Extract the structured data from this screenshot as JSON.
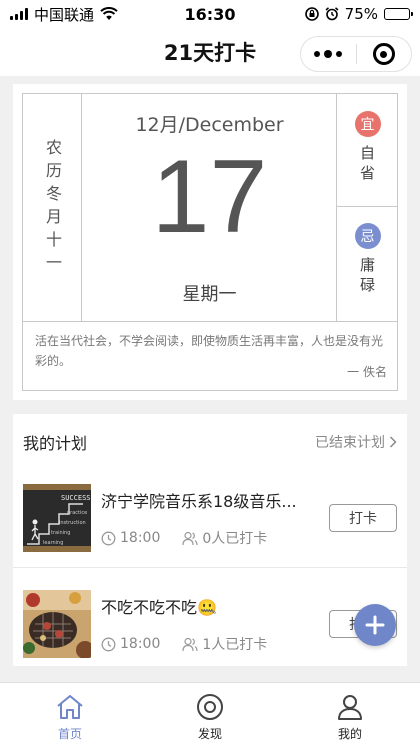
{
  "status_bar": {
    "carrier": "中国联通",
    "time": "16:30",
    "battery_text": "75%",
    "battery_level": 0.75,
    "icons": [
      "signal-icon",
      "wifi-icon",
      "rotation-lock-icon",
      "alarm-icon",
      "battery-icon"
    ]
  },
  "nav": {
    "title": "21天打卡",
    "more_icon": "more-dots-icon",
    "close_icon": "target-close-icon"
  },
  "calendar": {
    "lunar": "农历冬月十一",
    "month": "12月/December",
    "day": "17",
    "weekday": "星期一",
    "yi": {
      "badge": "宜",
      "text": "自省",
      "color": "#e8736c"
    },
    "ji": {
      "badge": "忌",
      "text": "庸碌",
      "color": "#7b8fd0"
    },
    "quote": "活在当代社会，不学会阅读，即使物质生活再丰富，人也是没有光彩的。",
    "author": "一 佚名"
  },
  "plans": {
    "title": "我的计划",
    "ended_label": "已结束计划",
    "items": [
      {
        "name": "济宁学院音乐系18级音乐...",
        "time": "18:00",
        "checkins": "0人已打卡",
        "button": "打卡",
        "thumb": "success-stairs-chalkboard"
      },
      {
        "name": "不吃不吃不吃🤐",
        "time": "18:00",
        "checkins": "1人已打卡",
        "button": "打卡",
        "thumb": "grill-food"
      }
    ]
  },
  "fab": {
    "icon": "plus-icon"
  },
  "tabs": [
    {
      "label": "首页",
      "icon": "home-icon",
      "active": true
    },
    {
      "label": "发现",
      "icon": "discover-icon",
      "active": false
    },
    {
      "label": "我的",
      "icon": "user-icon",
      "active": false
    }
  ],
  "colors": {
    "accent": "#6f86c8"
  }
}
